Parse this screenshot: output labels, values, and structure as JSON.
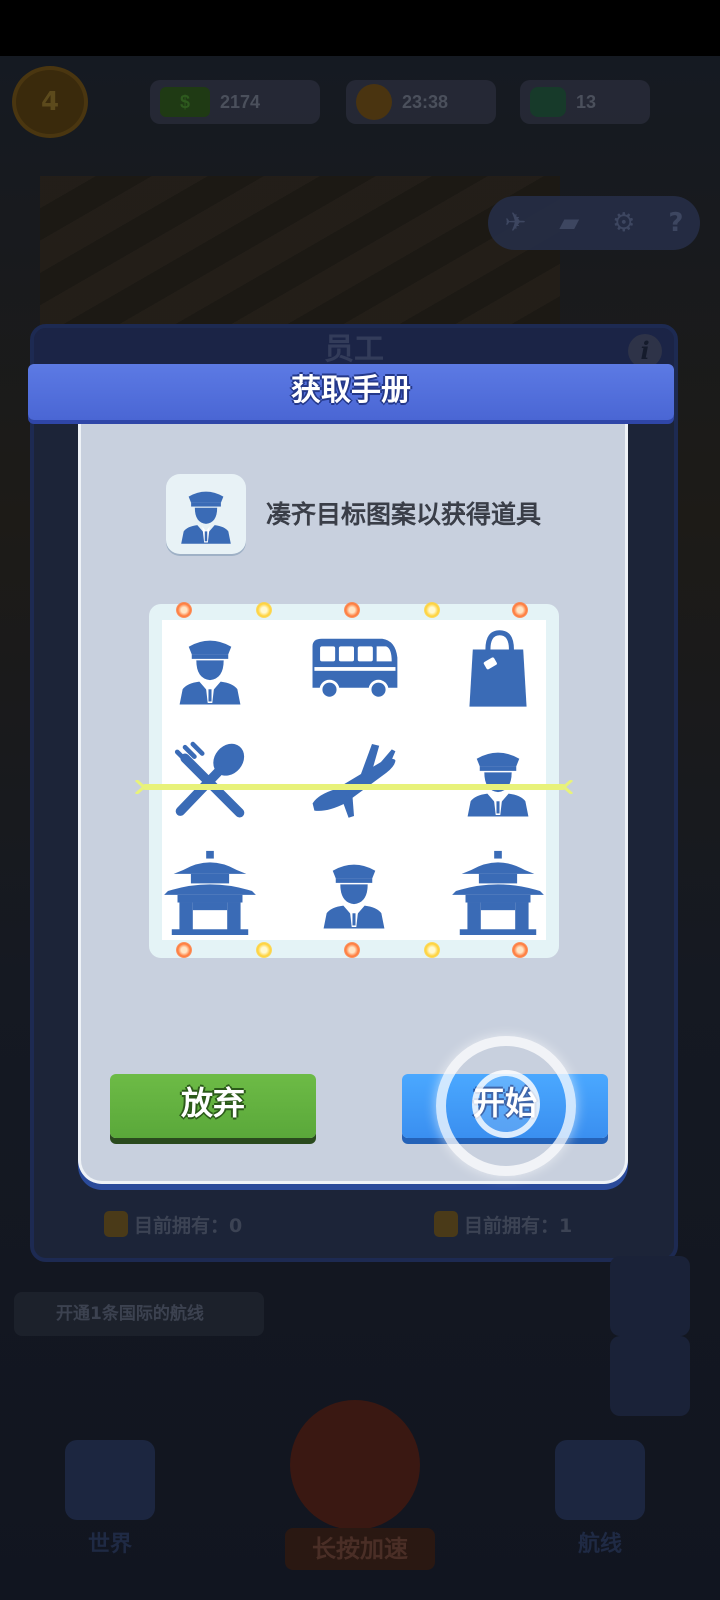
{
  "hud": {
    "level": "4",
    "money_chip": "$",
    "money": "2174",
    "timer": "23:38",
    "gems": "13"
  },
  "staff_panel": {
    "title": "员工",
    "info_glyph": "i",
    "owned_left": "目前拥有：0",
    "owned_right": "目前拥有：1"
  },
  "background": {
    "quest_text": "开通1条国际的航线",
    "speed_label": "长按加速",
    "nav_world": "世界",
    "nav_routes": "航线"
  },
  "modal": {
    "title": "获取手册",
    "instruction": "凑齐目标图案以获得道具",
    "target_icon": "pilot-icon",
    "reels": [
      [
        "pilot-icon",
        "bus-icon",
        "shopping-bag-icon"
      ],
      [
        "restaurant-icon",
        "airplane-icon",
        "pilot-icon"
      ],
      [
        "pagoda-icon",
        "pilot-icon",
        "pagoda-icon"
      ]
    ],
    "abandon_label": "放弃",
    "start_label": "开始"
  },
  "colors": {
    "icon_blue": "#3a6bb6",
    "win_line": "#e8f27a",
    "abandon_green": "#5aa83a",
    "start_blue": "#3a8ff0",
    "ribbon_blue": "#4a66d4"
  }
}
